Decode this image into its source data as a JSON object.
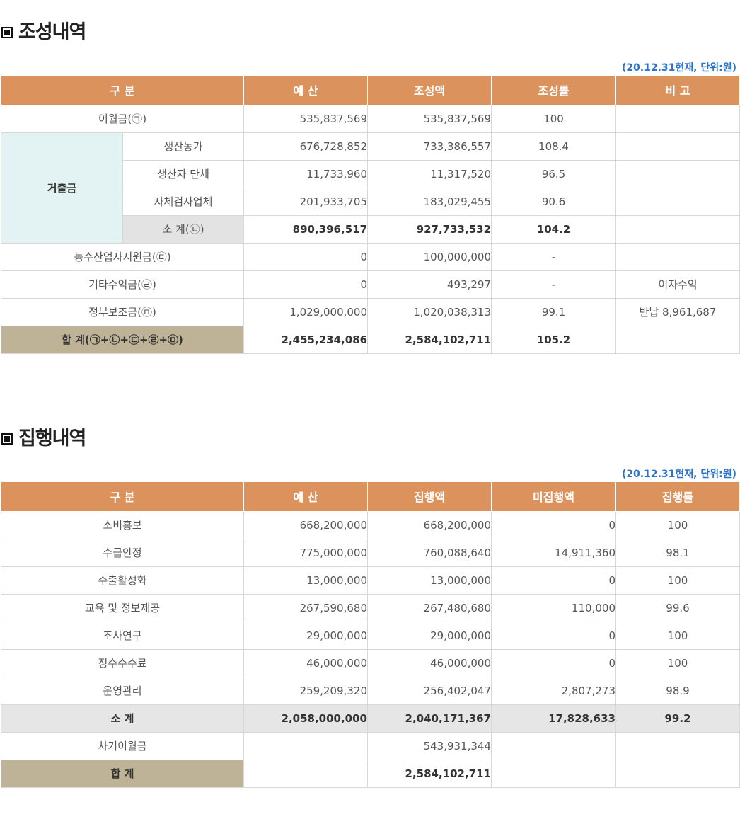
{
  "section1": {
    "title": "조성내역",
    "unit_note": "(20.12.31현재, 단위:원)",
    "headers": [
      "구 분",
      "예 산",
      "조성액",
      "조성률",
      "비 고"
    ],
    "rows": {
      "carryover": {
        "label": "이월금(㉠)",
        "budget": "535,837,569",
        "amount": "535,837,569",
        "rate": "100",
        "note": ""
      },
      "group_label": "거출금",
      "farmers": {
        "label": "생산농가",
        "budget": "676,728,852",
        "amount": "733,386,557",
        "rate": "108.4",
        "note": ""
      },
      "producer_groups": {
        "label": "생산자 단체",
        "budget": "11,733,960",
        "amount": "11,317,520",
        "rate": "96.5",
        "note": ""
      },
      "inspection": {
        "label": "자체검사업체",
        "budget": "201,933,705",
        "amount": "183,029,455",
        "rate": "90.6",
        "note": ""
      },
      "subtotal": {
        "label": "소 계(㉡)",
        "budget": "890,396,517",
        "amount": "927,733,532",
        "rate": "104.2",
        "note": ""
      },
      "fund_support": {
        "label": "농수산업자지원금(㉢)",
        "budget": "0",
        "amount": "100,000,000",
        "rate": "-",
        "note": ""
      },
      "other_income": {
        "label": "기타수익금(㉣)",
        "budget": "0",
        "amount": "493,297",
        "rate": "-",
        "note": "이자수익"
      },
      "gov_subsidy": {
        "label": "정부보조금(㉤)",
        "budget": "1,029,000,000",
        "amount": "1,020,038,313",
        "rate": "99.1",
        "note": "반납 8,961,687"
      },
      "total": {
        "label": "합 계(㉠+㉡+㉢+㉣+㉤)",
        "budget": "2,455,234,086",
        "amount": "2,584,102,711",
        "rate": "105.2",
        "note": ""
      }
    }
  },
  "section2": {
    "title": "집행내역",
    "unit_note": "(20.12.31현재, 단위:원)",
    "headers": [
      "구 분",
      "예 산",
      "집행액",
      "미집행액",
      "집행률"
    ],
    "rows": [
      {
        "label": "소비홍보",
        "budget": "668,200,000",
        "spent": "668,200,000",
        "unspent": "0",
        "rate": "100"
      },
      {
        "label": "수급안정",
        "budget": "775,000,000",
        "spent": "760,088,640",
        "unspent": "14,911,360",
        "rate": "98.1"
      },
      {
        "label": "수출활성화",
        "budget": "13,000,000",
        "spent": "13,000,000",
        "unspent": "0",
        "rate": "100"
      },
      {
        "label": "교육 및 정보제공",
        "budget": "267,590,680",
        "spent": "267,480,680",
        "unspent": "110,000",
        "rate": "99.6"
      },
      {
        "label": "조사연구",
        "budget": "29,000,000",
        "spent": "29,000,000",
        "unspent": "0",
        "rate": "100"
      },
      {
        "label": "징수수수료",
        "budget": "46,000,000",
        "spent": "46,000,000",
        "unspent": "0",
        "rate": "100"
      },
      {
        "label": "운영관리",
        "budget": "259,209,320",
        "spent": "256,402,047",
        "unspent": "2,807,273",
        "rate": "98.9"
      }
    ],
    "subtotal": {
      "label": "소 계",
      "budget": "2,058,000,000",
      "spent": "2,040,171,367",
      "unspent": "17,828,633",
      "rate": "99.2"
    },
    "carry_next": {
      "label": "차기이월금",
      "budget": "",
      "spent": "543,931,344",
      "unspent": "",
      "rate": ""
    },
    "total": {
      "label": "합 계",
      "budget": "",
      "spent": "2,584,102,711",
      "unspent": "",
      "rate": ""
    }
  }
}
